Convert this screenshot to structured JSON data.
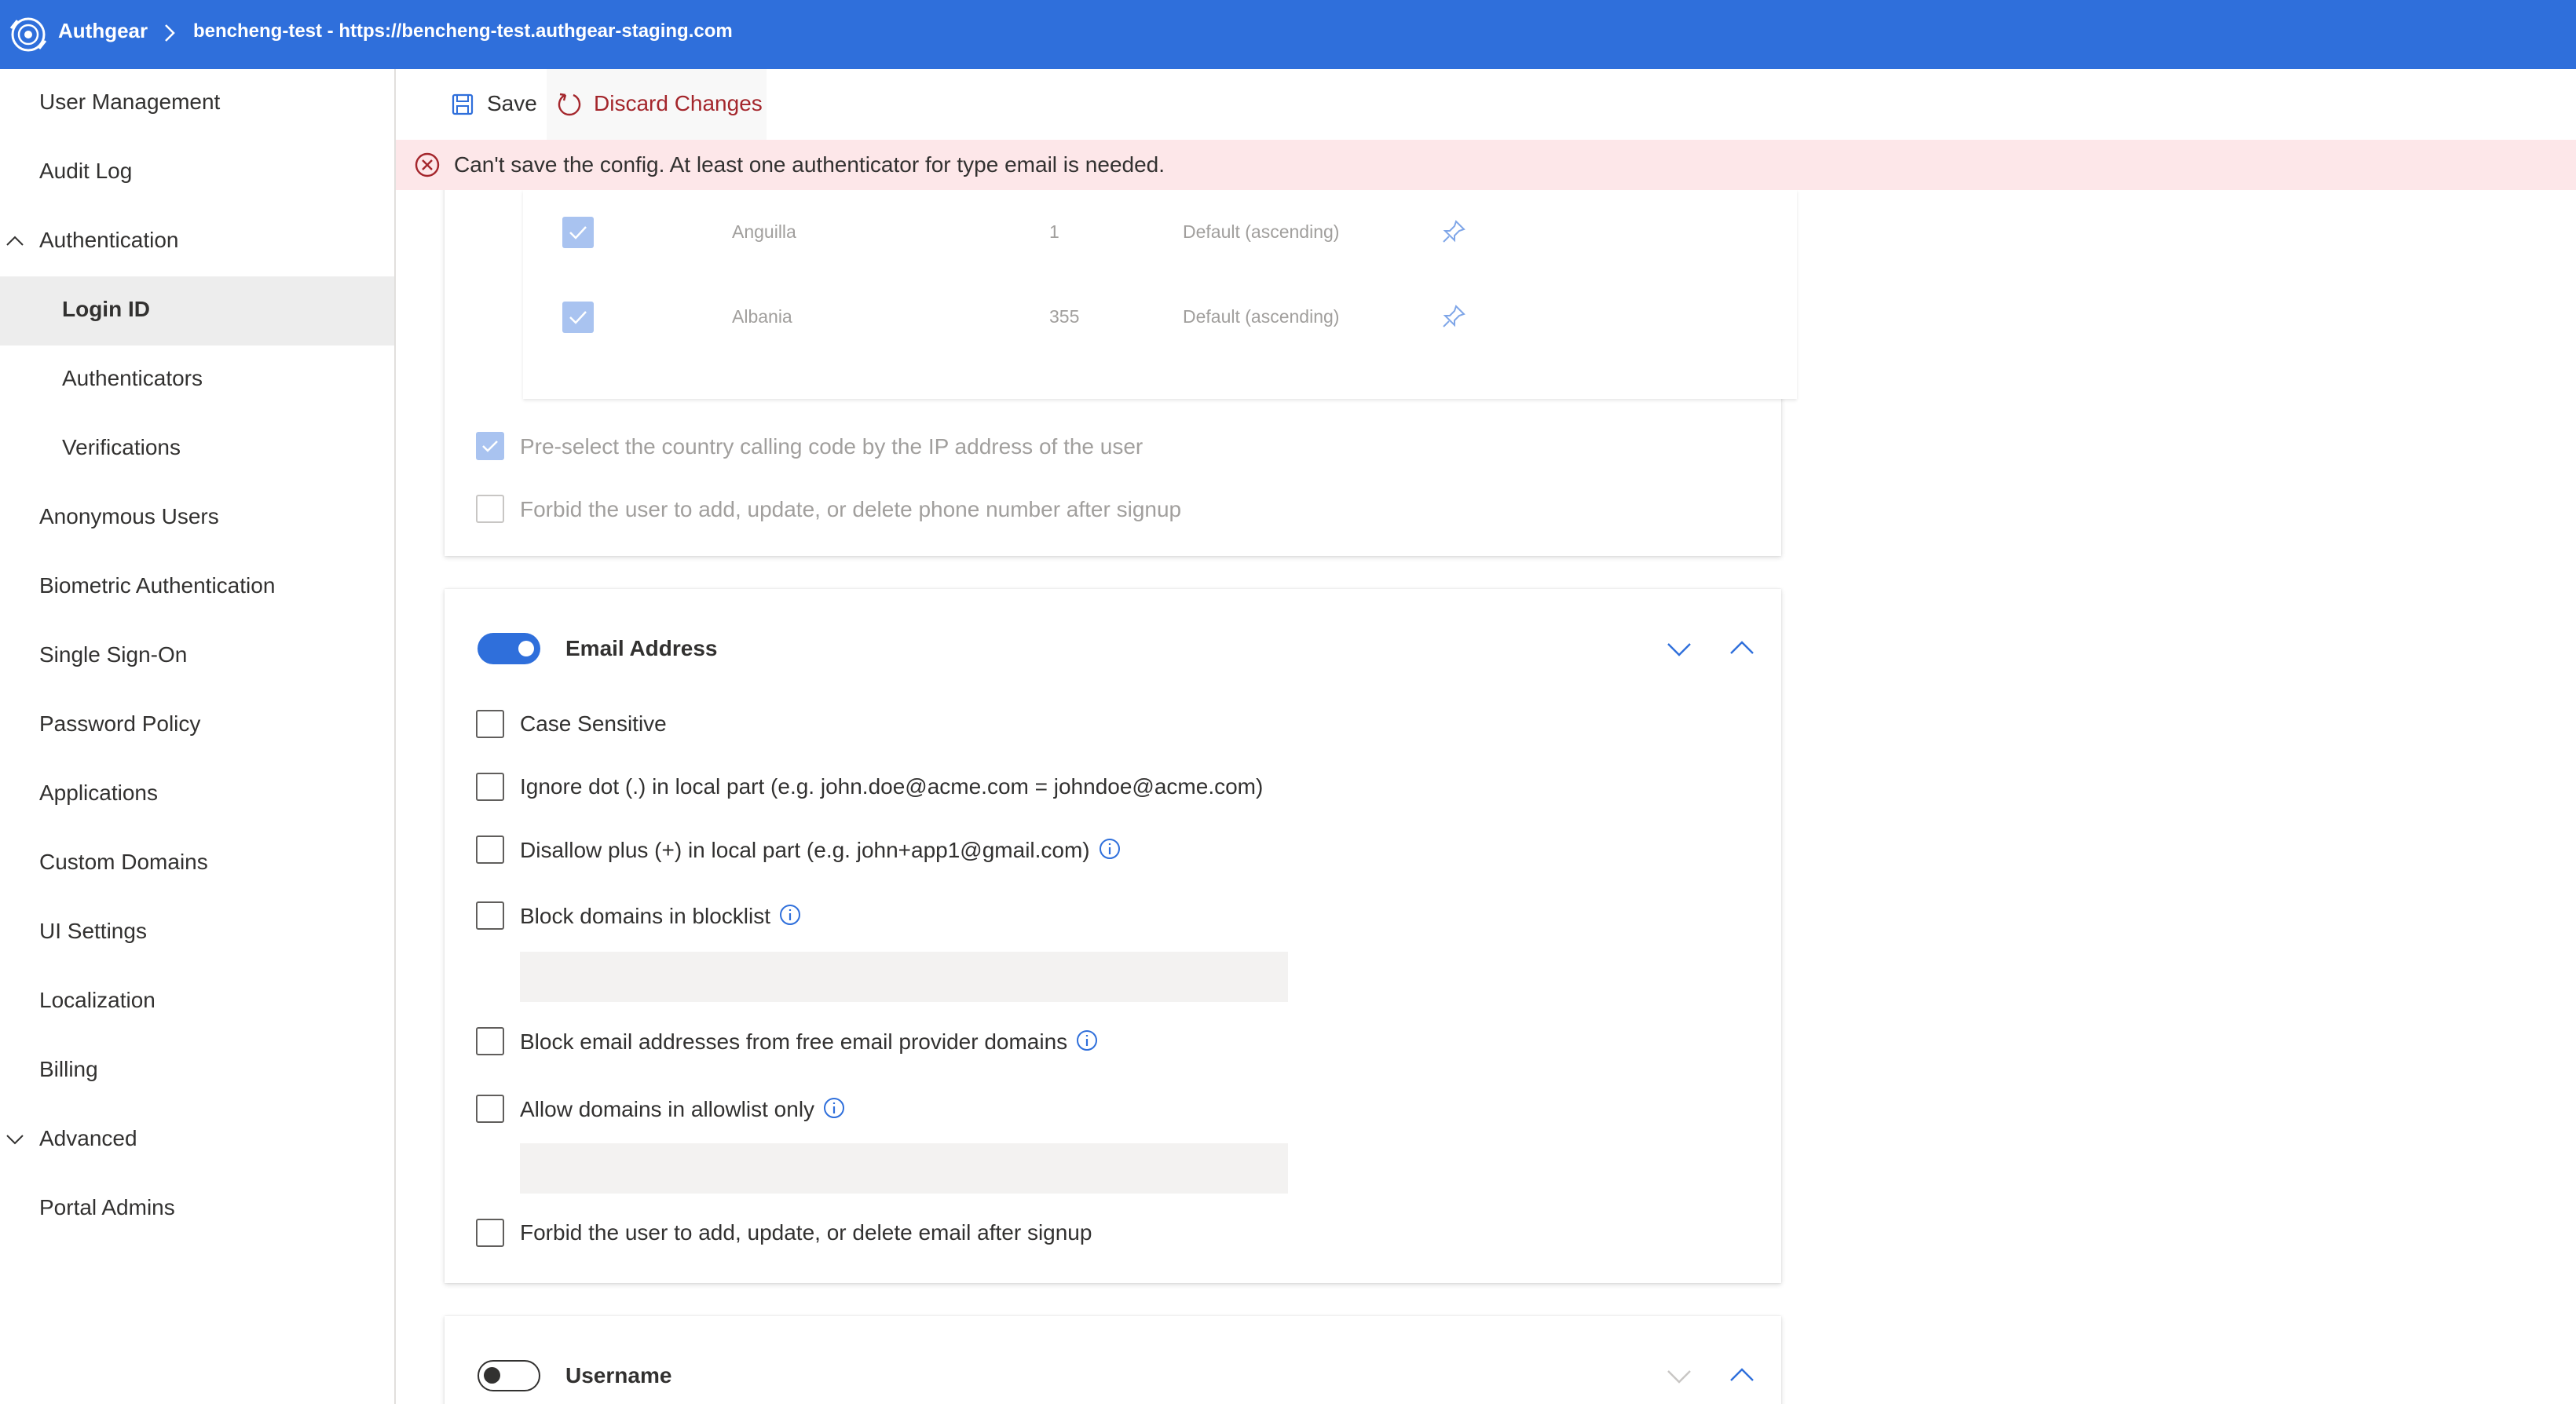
{
  "header": {
    "brand": "Authgear",
    "breadcrumb": "bencheng-test - https://bencheng-test.authgear-staging.com"
  },
  "sidebar": {
    "items": [
      {
        "label": "User Management"
      },
      {
        "label": "Audit Log"
      },
      {
        "label": "Authentication",
        "expanded": true
      },
      {
        "label": "Login ID",
        "selected": true
      },
      {
        "label": "Authenticators"
      },
      {
        "label": "Verifications"
      },
      {
        "label": "Anonymous Users"
      },
      {
        "label": "Biometric Authentication"
      },
      {
        "label": "Single Sign-On"
      },
      {
        "label": "Password Policy"
      },
      {
        "label": "Applications"
      },
      {
        "label": "Custom Domains"
      },
      {
        "label": "UI Settings"
      },
      {
        "label": "Localization"
      },
      {
        "label": "Billing"
      },
      {
        "label": "Advanced",
        "expanded": false
      },
      {
        "label": "Portal Admins"
      }
    ]
  },
  "commandbar": {
    "save_label": "Save",
    "discard_label": "Discard Changes"
  },
  "error": {
    "message": "Can't save the config. At least one authenticator for type email is needed."
  },
  "phone": {
    "countries": [
      {
        "name": "Anguilla",
        "code": "1",
        "order": "Default (ascending)",
        "checked": true
      },
      {
        "name": "Albania",
        "code": "355",
        "order": "Default (ascending)",
        "checked": true
      }
    ],
    "preselect_label": "Pre-select the country calling code by the IP address of the user",
    "preselect_checked": true,
    "forbid_label": "Forbid the user to add, update, or delete phone number after signup",
    "forbid_checked": false
  },
  "email": {
    "title": "Email Address",
    "enabled": true,
    "options": {
      "case_sensitive": "Case Sensitive",
      "ignore_dot": "Ignore dot (.) in local part (e.g. john.doe@acme.com = johndoe@acme.com)",
      "disallow_plus": "Disallow plus (+) in local part (e.g. john+app1@gmail.com)",
      "blocklist": "Block domains in blocklist",
      "free_provider": "Block email addresses from free email provider domains",
      "allowlist": "Allow domains in allowlist only",
      "forbid": "Forbid the user to add, update, or delete email after signup"
    },
    "blocklist_value": "",
    "allowlist_value": ""
  },
  "username": {
    "title": "Username",
    "enabled": false
  },
  "colors": {
    "accent": "#2f6fdb",
    "error_bg": "#fde7e9",
    "error_text": "#a4262c"
  }
}
